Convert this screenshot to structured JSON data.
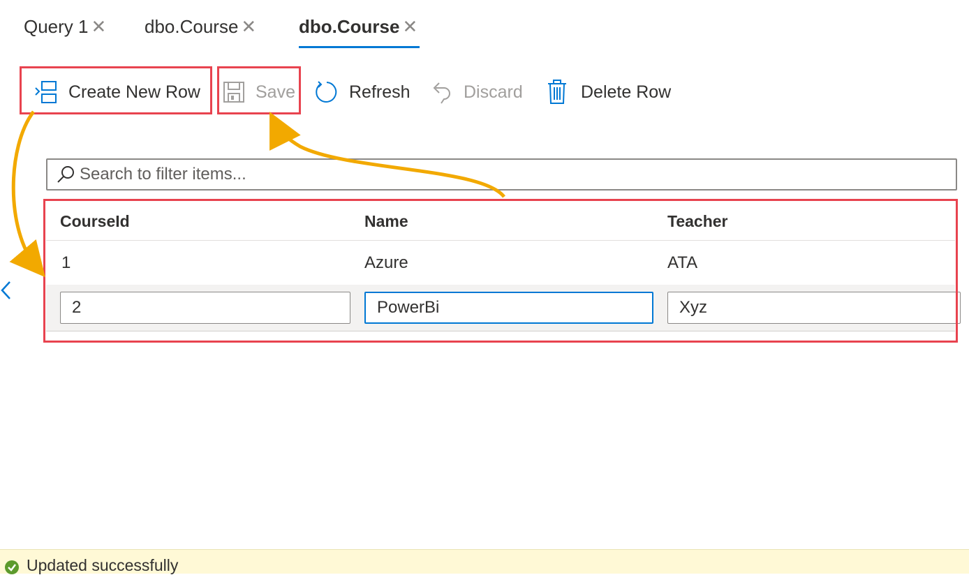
{
  "tabs": [
    {
      "label": "Query 1",
      "close": "✕",
      "active": false
    },
    {
      "label": "dbo.Course",
      "close": "✕",
      "active": false
    },
    {
      "label": "dbo.Course",
      "close": "✕",
      "active": true
    }
  ],
  "toolbar": {
    "create_new_row": "Create New Row",
    "save": "Save",
    "refresh": "Refresh",
    "discard": "Discard",
    "delete_row": "Delete Row"
  },
  "search": {
    "placeholder": "Search to filter items..."
  },
  "grid": {
    "columns": [
      "CourseId",
      "Name",
      "Teacher"
    ],
    "rows": [
      {
        "CourseId": "1",
        "Name": "Azure",
        "Teacher": "ATA"
      }
    ],
    "edit_row": {
      "CourseId": "2",
      "Name": "PowerBi",
      "Teacher": "Xyz"
    }
  },
  "status": {
    "message": "Updated successfully",
    "icon": "check-circle-icon"
  },
  "colors": {
    "accent": "#0078d4",
    "highlight": "#e8434f",
    "arrow": "#f2a900",
    "status_bg": "#fff9d6"
  }
}
